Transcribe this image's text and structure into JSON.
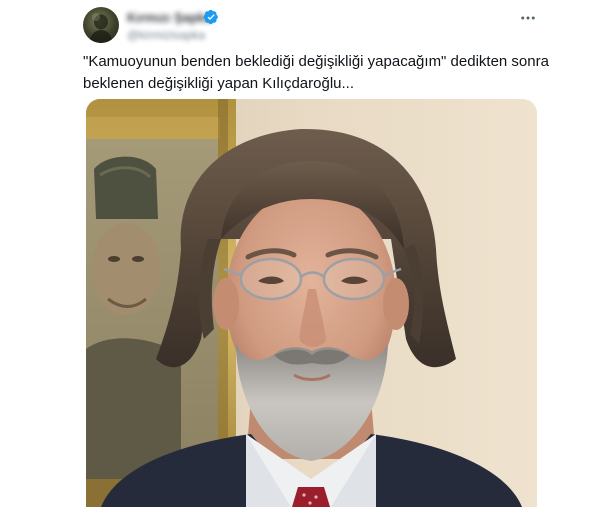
{
  "author": {
    "display_name": "Kırmızı Şapka",
    "handle": "@kirmizisapka"
  },
  "tweet": {
    "line1": "\"Kamuoyunun benden beklediği değişikliği yapacağım\" dedikten sonra",
    "line2": "beklenen değişikliği yapan Kılıçdaroğlu..."
  },
  "media": {
    "alt": "Image"
  },
  "icons": {
    "verified": "verified-badge-icon",
    "more": "more-horizontal-icon"
  },
  "colors": {
    "text": "#0f1419",
    "secondary": "#536471",
    "verified": "#1d9bf0"
  }
}
